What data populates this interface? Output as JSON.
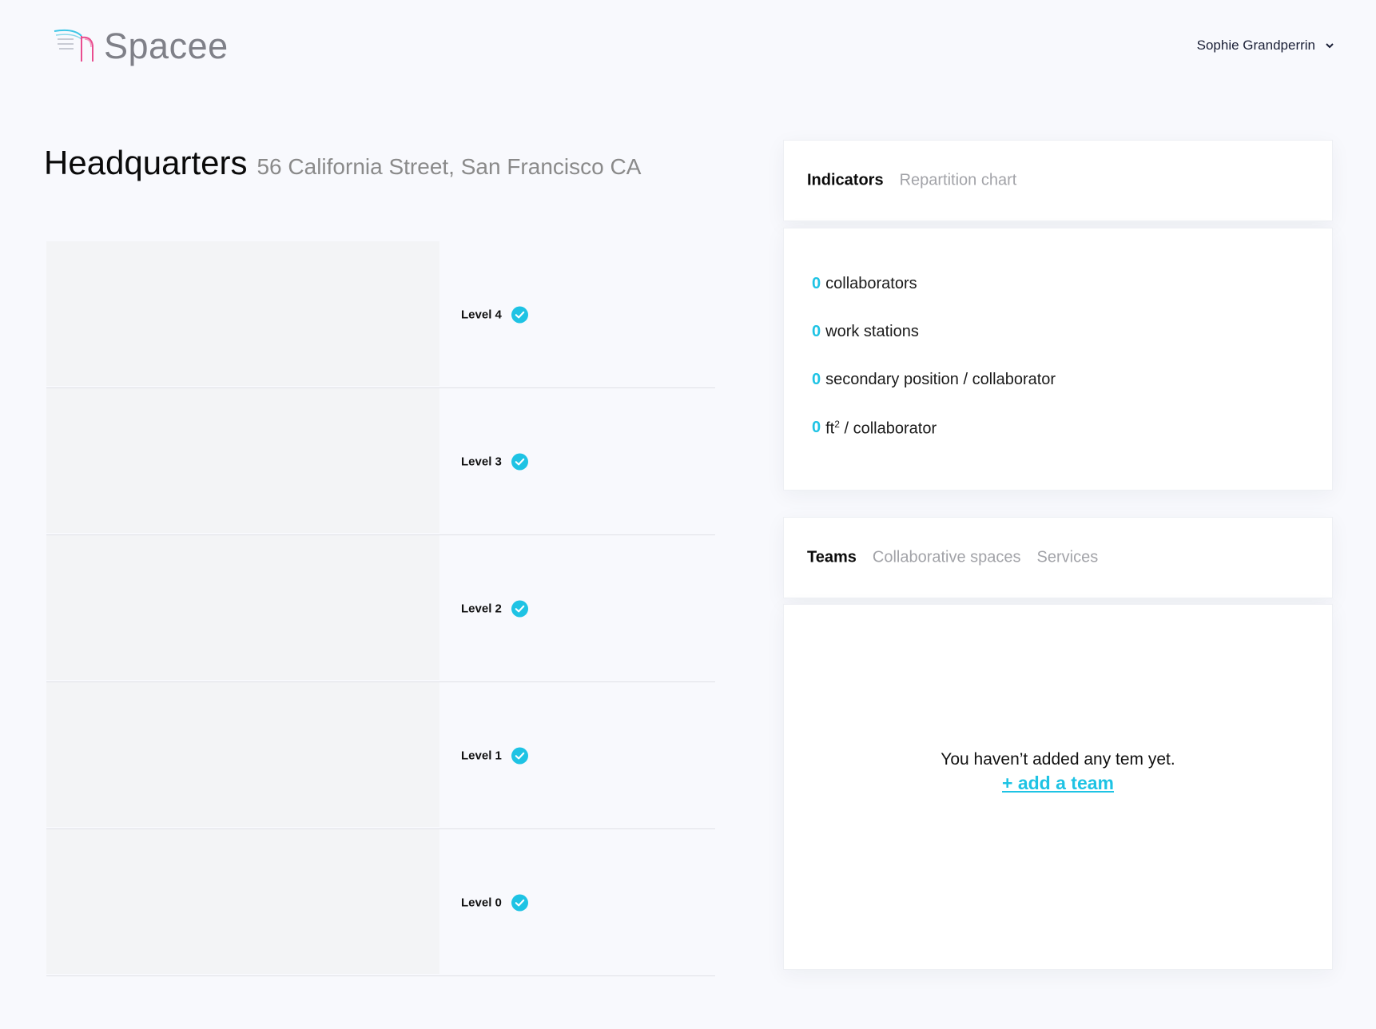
{
  "header": {
    "brand": "Spacee",
    "user_name": "Sophie Grandperrin"
  },
  "page": {
    "title": "Headquarters",
    "address": "56 California Street, San Francisco CA"
  },
  "levels": [
    {
      "label": "Level 4"
    },
    {
      "label": "Level 3"
    },
    {
      "label": "Level 2"
    },
    {
      "label": "Level 1"
    },
    {
      "label": "Level 0"
    }
  ],
  "indicators_tabs": [
    "Indicators",
    "Repartition chart"
  ],
  "indicators": [
    {
      "value": "0",
      "label": "collaborators"
    },
    {
      "value": "0",
      "label": "work stations"
    },
    {
      "value": "0",
      "label": "secondary position / collaborator"
    },
    {
      "value": "0",
      "label_prefix": "ft",
      "label_sup": "2",
      "label_suffix": " / collaborator"
    }
  ],
  "teams_tabs": [
    "Teams",
    "Collaborative spaces",
    "Services"
  ],
  "teams": {
    "empty_text": "You haven’t added any tem yet.",
    "add_link": "+ add a team"
  },
  "colors": {
    "accent": "#1ec3e4",
    "background": "#f8f9fd"
  }
}
